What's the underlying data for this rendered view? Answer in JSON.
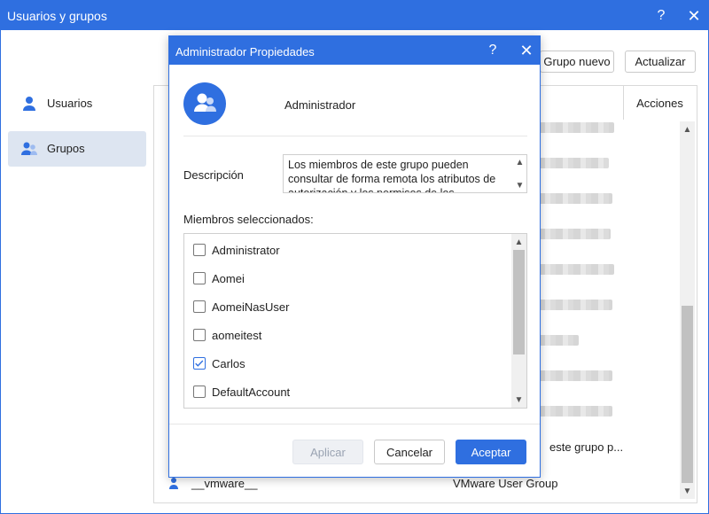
{
  "window": {
    "title": "Usuarios y grupos",
    "help": "?",
    "close": "✕"
  },
  "sidebar": {
    "items": [
      {
        "label": "Usuarios",
        "icon": "user-icon"
      },
      {
        "label": "Grupos",
        "icon": "group-icon",
        "active": true
      }
    ]
  },
  "toolbar": {
    "new_group": "Grupo nuevo",
    "refresh": "Actualizar"
  },
  "table": {
    "actions_header": "Acciones",
    "visible_rows": [
      {
        "name": "__vmware__",
        "description": "VMware User Group"
      }
    ],
    "partial_description": "este grupo p..."
  },
  "dialog": {
    "title": "Administrador Propiedades",
    "help": "?",
    "close": "✕",
    "group_name": "Administrador",
    "description_label": "Descripción",
    "description_text": "Los miembros de este grupo pueden consultar de forma remota los atributos de autorización y los permisos de los",
    "members_label": "Miembros seleccionados:",
    "members": [
      {
        "name": "Administrator",
        "checked": false
      },
      {
        "name": "Aomei",
        "checked": false
      },
      {
        "name": "AomeiNasUser",
        "checked": false
      },
      {
        "name": "aomeitest",
        "checked": false
      },
      {
        "name": "Carlos",
        "checked": true
      },
      {
        "name": "DefaultAccount",
        "checked": false
      }
    ],
    "buttons": {
      "apply": "Aplicar",
      "cancel": "Cancelar",
      "accept": "Aceptar"
    }
  },
  "colors": {
    "accent": "#2f6fe0",
    "active_nav": "#dde5f1",
    "disabled_button": "#eef0f4"
  }
}
